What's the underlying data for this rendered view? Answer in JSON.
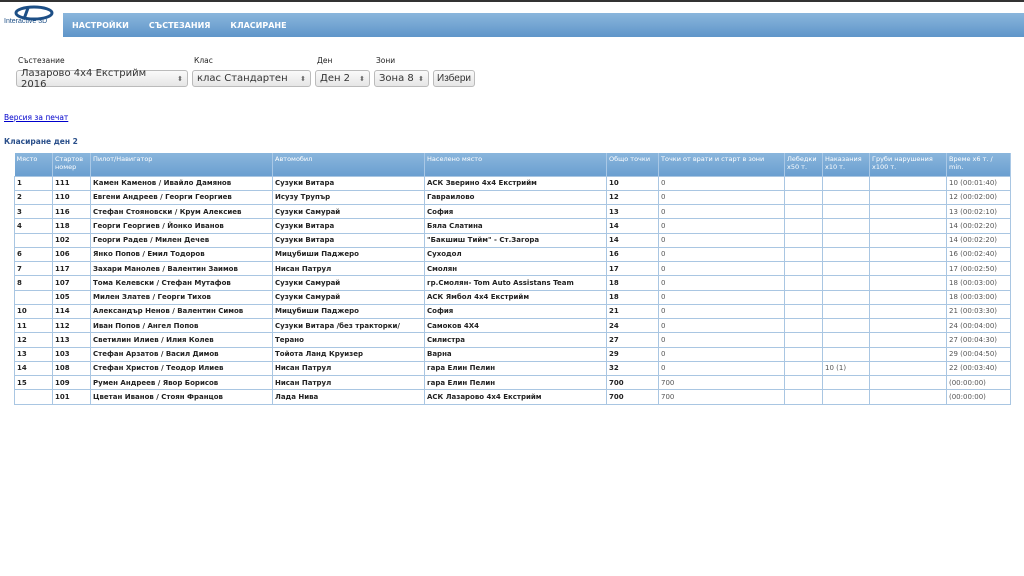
{
  "logo": {
    "text": "Interactive 3D"
  },
  "nav": [
    "НАСТРОЙКИ",
    "СЪСТЕЗАНИЯ",
    "КЛАСИРАНЕ"
  ],
  "filters": {
    "competition": {
      "label": "Състезание",
      "value": "Лазарово 4x4 Екстрийм 2016"
    },
    "class": {
      "label": "Клас",
      "value": "клас Стандартен"
    },
    "day": {
      "label": "Ден",
      "value": "Ден 2"
    },
    "zone": {
      "label": "Зони",
      "value": "Зона 8"
    },
    "submit": "Избери"
  },
  "print_link": "Версия за печат",
  "section_title": "Класиране ден 2",
  "table": {
    "headers": [
      "Място",
      "Стартов номер",
      "Пилот/Навигатор",
      "Автомобил",
      "Населено място",
      "Общо точки",
      "Точки от врати и старт в зони",
      "Лебедки x50 т.",
      "Наказания x10 т.",
      "Груби нарушения x100 т.",
      "Време x6 т. / min."
    ],
    "rows": [
      [
        "1",
        "111",
        "Камен Каменов / Ивайло Дамянов",
        "Сузуки Витара",
        "АСК Зверино 4x4 Екстрийм",
        "10",
        "0",
        "",
        "",
        "",
        "10 (00:01:40)"
      ],
      [
        "2",
        "110",
        "Евгени Андреев / Георги Георгиев",
        "Исузу Трупър",
        "Гавраилово",
        "12",
        "0",
        "",
        "",
        "",
        "12 (00:02:00)"
      ],
      [
        "3",
        "116",
        "Стефан Стояновски / Крум Алексиев",
        "Сузуки Самурай",
        "София",
        "13",
        "0",
        "",
        "",
        "",
        "13 (00:02:10)"
      ],
      [
        "4",
        "118",
        "Георги Георгиев / Йонко Иванов",
        "Сузуки Витара",
        "Бяла Слатина",
        "14",
        "0",
        "",
        "",
        "",
        "14 (00:02:20)"
      ],
      [
        "",
        "102",
        "Георги Радев / Милен Дечев",
        "Сузуки Витара",
        "\"Бакшиш Тийм\" - Ст.Загора",
        "14",
        "0",
        "",
        "",
        "",
        "14 (00:02:20)"
      ],
      [
        "6",
        "106",
        "Янко Попов / Емил Тодоров",
        "Мицубиши Паджеро",
        "Суходол",
        "16",
        "0",
        "",
        "",
        "",
        "16 (00:02:40)"
      ],
      [
        "7",
        "117",
        "Захари Манолев / Валентин Заимов",
        "Нисан Патрул",
        "Смолян",
        "17",
        "0",
        "",
        "",
        "",
        "17 (00:02:50)"
      ],
      [
        "8",
        "107",
        "Тома Келевски / Стефан Мутафов",
        "Сузуки Самурай",
        "гр.Смолян- Tom Auto Assistans Team",
        "18",
        "0",
        "",
        "",
        "",
        "18 (00:03:00)"
      ],
      [
        "",
        "105",
        "Милен Златев / Георги Тихов",
        "Сузуки Самурай",
        "АСК Ямбол 4x4 Екстрийм",
        "18",
        "0",
        "",
        "",
        "",
        "18 (00:03:00)"
      ],
      [
        "10",
        "114",
        "Александър Ненов / Валентин Симов",
        "Мицубиши Паджеро",
        "София",
        "21",
        "0",
        "",
        "",
        "",
        "21 (00:03:30)"
      ],
      [
        "11",
        "112",
        "Иван Попов / Ангел Попов",
        "Сузуки Витара /без тракторки/",
        "Самоков 4X4",
        "24",
        "0",
        "",
        "",
        "",
        "24 (00:04:00)"
      ],
      [
        "12",
        "113",
        "Светилин Илиев / Илия Колев",
        "Терано",
        "Силистра",
        "27",
        "0",
        "",
        "",
        "",
        "27 (00:04:30)"
      ],
      [
        "13",
        "103",
        "Стефан Арзатов / Васил Димов",
        "Тойота Ланд Круизер",
        "Варна",
        "29",
        "0",
        "",
        "",
        "",
        "29 (00:04:50)"
      ],
      [
        "14",
        "108",
        "Стефан Христов / Теодор Илиев",
        "Нисан Патрул",
        "гара Елин Пелин",
        "32",
        "0",
        "",
        "10 (1)",
        "",
        "22 (00:03:40)"
      ],
      [
        "15",
        "109",
        "Румен Андреев / Явор Борисов",
        "Нисан Патрул",
        "гара Елин Пелин",
        "700",
        "700",
        "",
        "",
        "",
        "(00:00:00)"
      ],
      [
        "",
        "101",
        "Цветан Иванов / Стоян Францов",
        "Лада Нива",
        "АСК Лазарово 4x4 Екстрийм",
        "700",
        "700",
        "",
        "",
        "",
        "(00:00:00)"
      ]
    ]
  }
}
